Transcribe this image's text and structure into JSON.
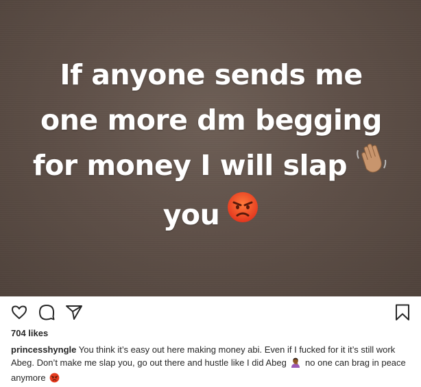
{
  "story": {
    "lines": [
      "If anyone sends me",
      "one more dm begging",
      "for money I will slap",
      "you"
    ],
    "emoji_after_line3": "waving-hand-emoji",
    "emoji_after_line4": "angry-face-emoji"
  },
  "actions": {
    "like_icon": "heart-icon",
    "comment_icon": "comment-bubble-icon",
    "share_icon": "paper-plane-icon",
    "save_icon": "bookmark-icon"
  },
  "likes": {
    "text": "704 likes"
  },
  "caption": {
    "username": "princesshyngle",
    "text_part1": " You think it’s easy out here making money abi. Even if I fucked for it it’s still work Abeg. Don’t make me slap you, go out there and hustle like I did Abeg ",
    "emoji1": "person-facepalming-emoji",
    "text_part2": " no one can brag in peace anymore ",
    "emoji2": "angry-face-emoji"
  },
  "colors": {
    "story_background": "#5f5048",
    "story_text": "#ffffff",
    "text": "#262626",
    "icon": "#262626"
  }
}
